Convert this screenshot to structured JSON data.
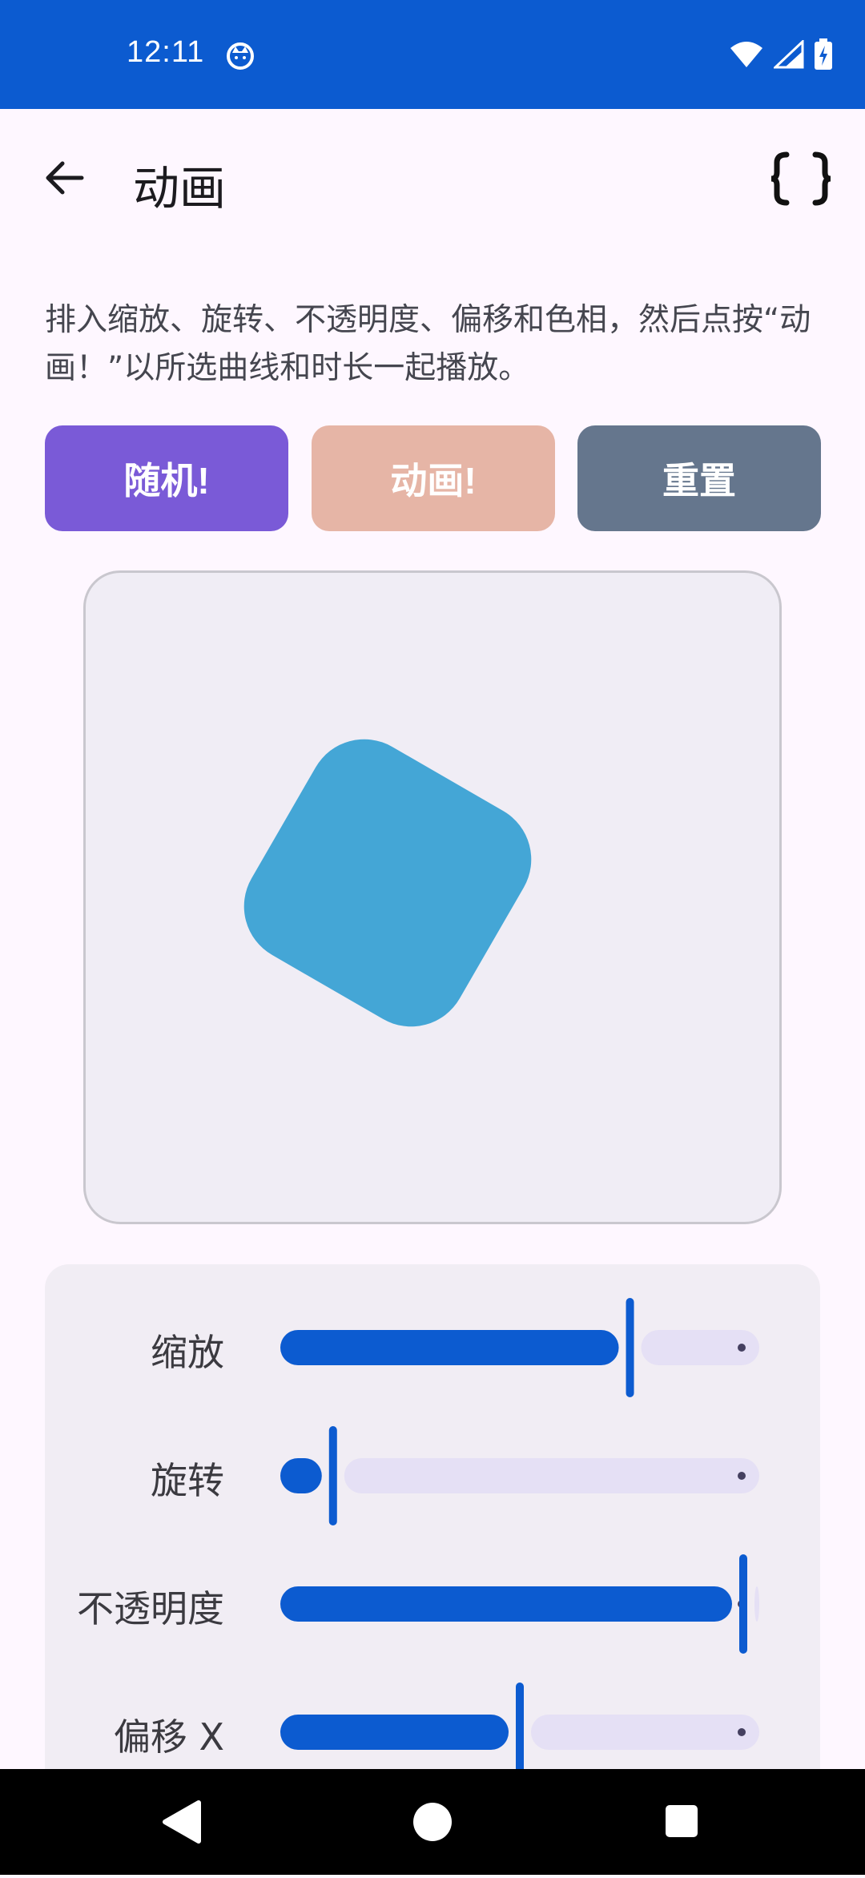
{
  "status_bar": {
    "time": "12:11",
    "icons": [
      "cat-notification-icon",
      "wifi-icon",
      "cellular-signal-icon",
      "battery-charging-icon"
    ]
  },
  "app_bar": {
    "title": "动画",
    "back_icon": "arrow-left-icon",
    "action_icon": "curly-braces-icon"
  },
  "description": "排入缩放、旋转、不透明度、偏移和色相，然后点按“动画！”以所选曲线和时长一起播放。",
  "buttons": {
    "random_label": "随机!",
    "animate_label": "动画!",
    "reset_label": "重置"
  },
  "preview": {
    "shape_color": "#44A6D6",
    "rotation_deg": 30
  },
  "sliders": [
    {
      "label": "缩放",
      "value": 0.73
    },
    {
      "label": "旋转",
      "value": 0.11
    },
    {
      "label": "不透明度",
      "value": 1.0
    },
    {
      "label": "偏移 X",
      "value": 0.5
    }
  ],
  "colors": {
    "primary": "#0C5BD0",
    "track_inactive": "#E5E0F5",
    "random_button": "#7A5AD7",
    "animate_button": "#E6B5A6",
    "reset_button": "#65768D"
  },
  "nav_bar": {
    "icons": [
      "back-triangle-icon",
      "home-circle-icon",
      "recents-square-icon"
    ]
  }
}
